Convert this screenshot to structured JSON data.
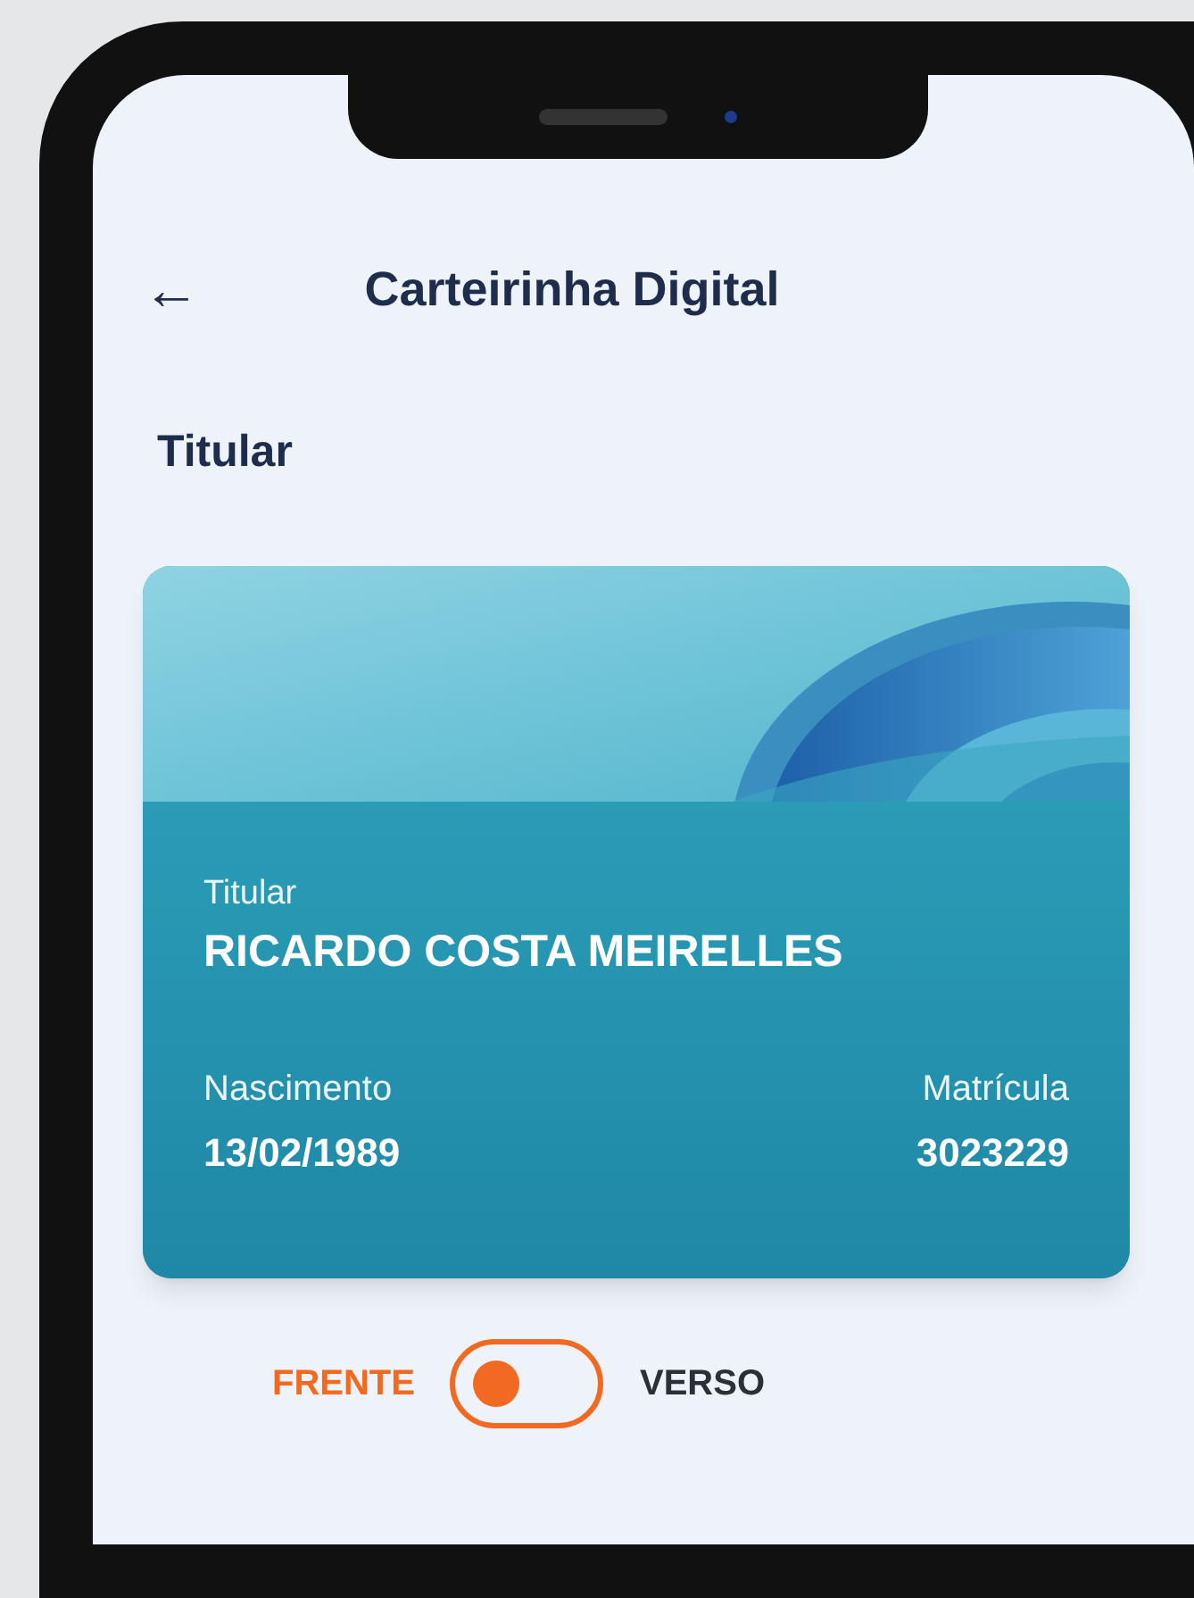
{
  "header": {
    "back": "←",
    "title": "Carteirinha Digital"
  },
  "section_title": "Titular",
  "card": {
    "holder_label": "Titular",
    "holder_name": "RICARDO COSTA MEIRELLES",
    "birth_label": "Nascimento",
    "birth_date": "13/02/1989",
    "id_label": "Matrícula",
    "id_number": "3023229"
  },
  "side_toggle": {
    "options": [
      {
        "label": "FRENTE",
        "selected": true
      },
      {
        "label": "VERSO",
        "selected": false
      }
    ]
  }
}
